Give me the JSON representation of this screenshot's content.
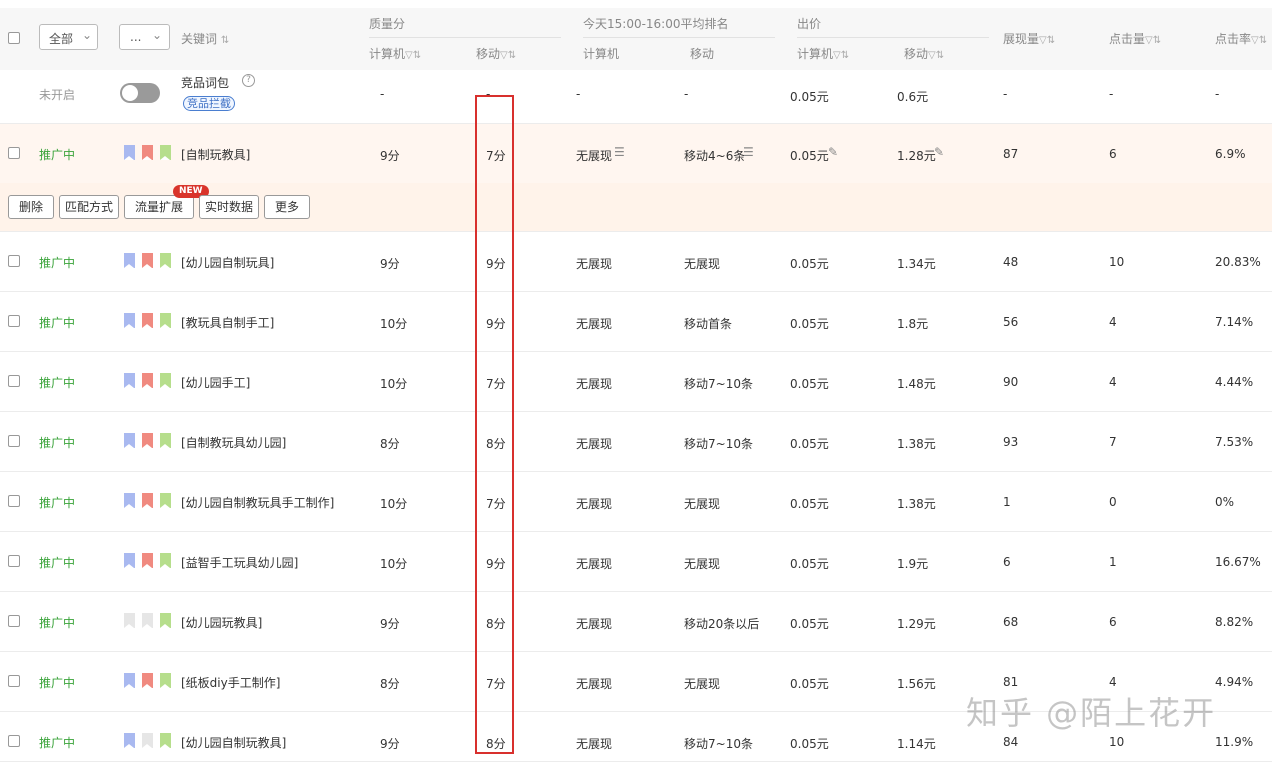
{
  "header": {
    "filter_all": "全部",
    "filter_more": "...",
    "keyword": "关键词",
    "quality": "质量分",
    "rank_group": "今天15:00-16:00平均排名",
    "bid_group": "出价",
    "pc": "计算机",
    "mobile": "移动",
    "impressions": "展现量",
    "clicks": "点击量",
    "ctr": "点击率"
  },
  "competitor_row": {
    "status": "未开启",
    "name": "竞品词包",
    "tag": "竞品拦截",
    "quality_pc": "-",
    "quality_mobile": "-",
    "rank_pc": "-",
    "rank_mobile": "-",
    "bid_pc": "0.05元",
    "bid_mobile": "0.6元",
    "impressions": "-",
    "clicks": "-",
    "ctr": "-"
  },
  "action_bar": {
    "delete": "删除",
    "match": "匹配方式",
    "expand": "流量扩展",
    "new_badge": "NEW",
    "realtime": "实时数据",
    "more": "更多"
  },
  "rows": [
    {
      "status": "推广中",
      "keyword": "[自制玩教具]",
      "q_pc": "9分",
      "q_mobile": "7分",
      "r_pc": "无展现",
      "r_mobile": "移动4~6条",
      "bid_pc": "0.05元",
      "bid_mobile": "1.28元",
      "imp": "87",
      "clk": "6",
      "ctr": "6.9%"
    },
    {
      "status": "推广中",
      "keyword": "[幼儿园自制玩具]",
      "q_pc": "9分",
      "q_mobile": "9分",
      "r_pc": "无展现",
      "r_mobile": "无展现",
      "bid_pc": "0.05元",
      "bid_mobile": "1.34元",
      "imp": "48",
      "clk": "10",
      "ctr": "20.83%"
    },
    {
      "status": "推广中",
      "keyword": "[教玩具自制手工]",
      "q_pc": "10分",
      "q_mobile": "9分",
      "r_pc": "无展现",
      "r_mobile": "移动首条",
      "bid_pc": "0.05元",
      "bid_mobile": "1.8元",
      "imp": "56",
      "clk": "4",
      "ctr": "7.14%"
    },
    {
      "status": "推广中",
      "keyword": "[幼儿园手工]",
      "q_pc": "10分",
      "q_mobile": "7分",
      "r_pc": "无展现",
      "r_mobile": "移动7~10条",
      "bid_pc": "0.05元",
      "bid_mobile": "1.48元",
      "imp": "90",
      "clk": "4",
      "ctr": "4.44%"
    },
    {
      "status": "推广中",
      "keyword": "[自制教玩具幼儿园]",
      "q_pc": "8分",
      "q_mobile": "8分",
      "r_pc": "无展现",
      "r_mobile": "移动7~10条",
      "bid_pc": "0.05元",
      "bid_mobile": "1.38元",
      "imp": "93",
      "clk": "7",
      "ctr": "7.53%"
    },
    {
      "status": "推广中",
      "keyword": "[幼儿园自制教玩具手工制作]",
      "q_pc": "10分",
      "q_mobile": "7分",
      "r_pc": "无展现",
      "r_mobile": "无展现",
      "bid_pc": "0.05元",
      "bid_mobile": "1.38元",
      "imp": "1",
      "clk": "0",
      "ctr": "0%"
    },
    {
      "status": "推广中",
      "keyword": "[益智手工玩具幼儿园]",
      "q_pc": "10分",
      "q_mobile": "9分",
      "r_pc": "无展现",
      "r_mobile": "无展现",
      "bid_pc": "0.05元",
      "bid_mobile": "1.9元",
      "imp": "6",
      "clk": "1",
      "ctr": "16.67%"
    },
    {
      "status": "推广中",
      "keyword": "[幼儿园玩教具]",
      "q_pc": "9分",
      "q_mobile": "8分",
      "r_pc": "无展现",
      "r_mobile": "移动20条以后",
      "bid_pc": "0.05元",
      "bid_mobile": "1.29元",
      "imp": "68",
      "clk": "6",
      "ctr": "8.82%"
    },
    {
      "status": "推广中",
      "keyword": "[纸板diy手工制作]",
      "q_pc": "8分",
      "q_mobile": "7分",
      "r_pc": "无展现",
      "r_mobile": "无展现",
      "bid_pc": "0.05元",
      "bid_mobile": "1.56元",
      "imp": "81",
      "clk": "4",
      "ctr": "4.94%"
    },
    {
      "status": "推广中",
      "keyword": "[幼儿园自制玩教具]",
      "q_pc": "9分",
      "q_mobile": "8分",
      "r_pc": "无展现",
      "r_mobile": "移动7~10条",
      "bid_pc": "0.05元",
      "bid_mobile": "1.14元",
      "imp": "84",
      "clk": "10",
      "ctr": "11.9%"
    }
  ],
  "watermark": "知乎 @陌上花开",
  "colors": {
    "flag_blue": "#a9b9f0",
    "flag_red": "#f08a80",
    "flag_green": "#b6de8c",
    "flag_grey": "#e6e6e6",
    "highlight": "#d8302d"
  }
}
